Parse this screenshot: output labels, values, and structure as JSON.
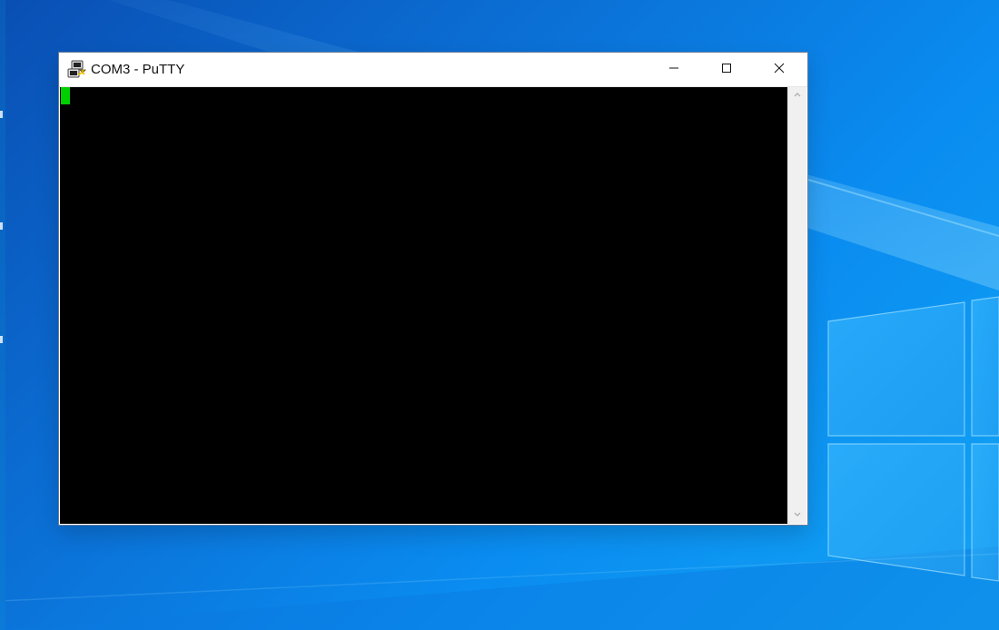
{
  "window": {
    "title": "COM3 - PuTTY"
  },
  "icons": {
    "app": "putty-icon",
    "minimize": "minimize-icon",
    "maximize": "maximize-icon",
    "close": "close-icon",
    "scroll_up": "chevron-up-icon",
    "scroll_down": "chevron-down-icon"
  },
  "colors": {
    "terminal_background": "#000000",
    "cursor": "#00d000",
    "desktop_blue": "#0b70d6"
  }
}
